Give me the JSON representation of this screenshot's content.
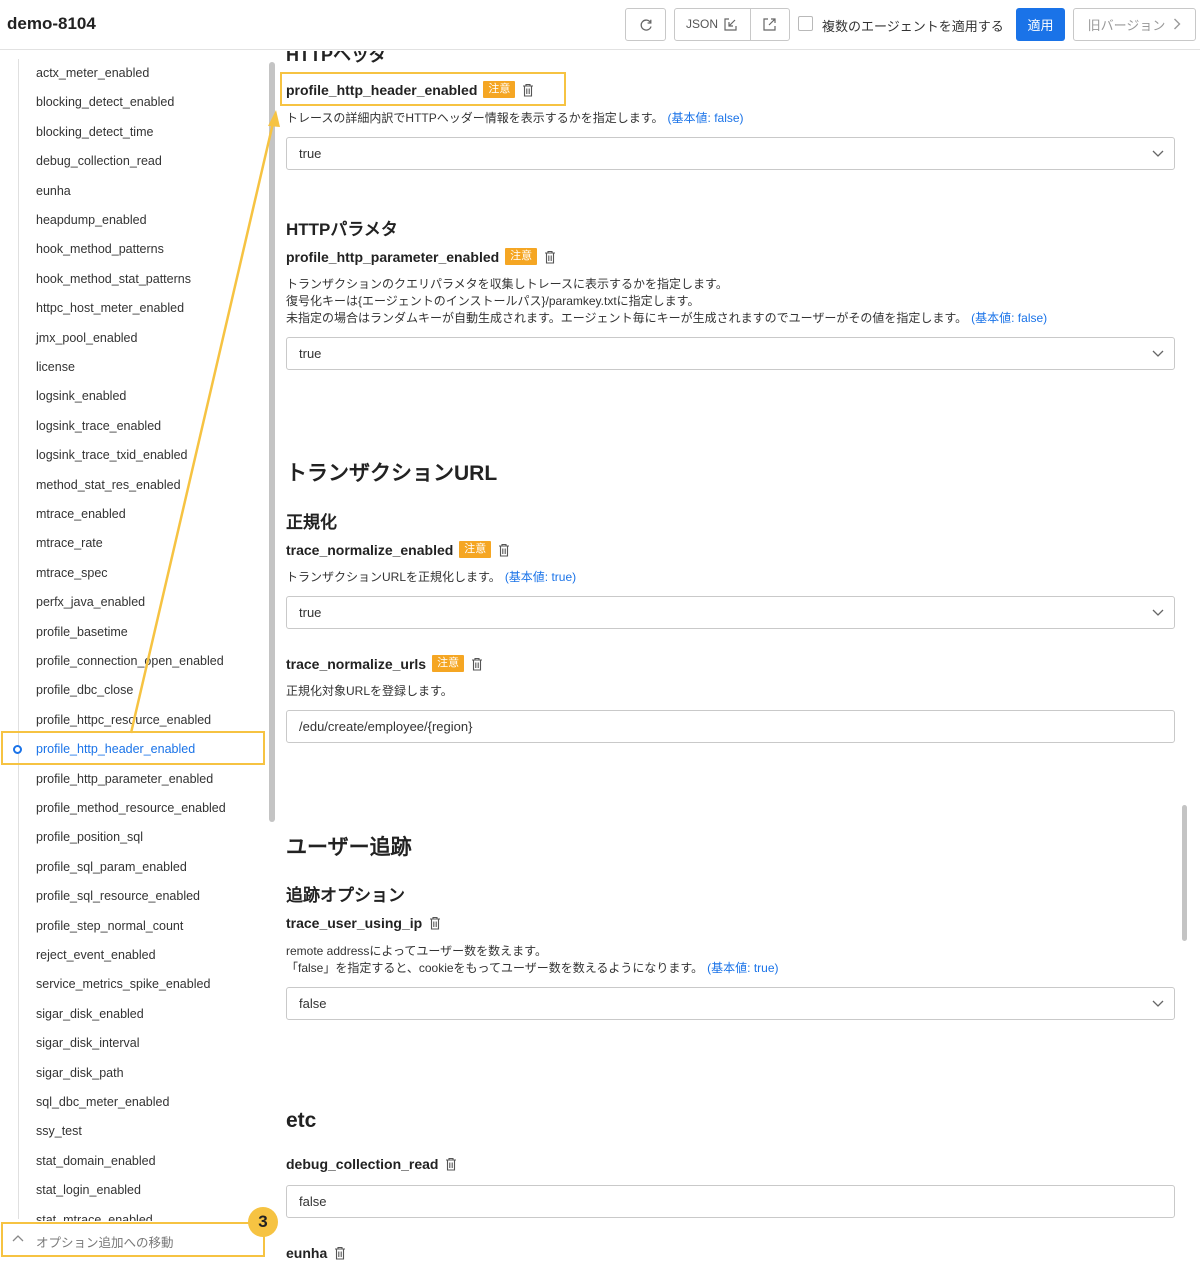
{
  "header": {
    "title": "demo-8104",
    "json_label": "JSON",
    "multi_agent_label": "複数のエージェントを適用する",
    "apply_label": "適用",
    "old_version_label": "旧バージョン"
  },
  "sidebar": {
    "items": [
      "actx_meter_enabled",
      "blocking_detect_enabled",
      "blocking_detect_time",
      "debug_collection_read",
      "eunha",
      "heapdump_enabled",
      "hook_method_patterns",
      "hook_method_stat_patterns",
      "httpc_host_meter_enabled",
      "jmx_pool_enabled",
      "license",
      "logsink_enabled",
      "logsink_trace_enabled",
      "logsink_trace_txid_enabled",
      "method_stat_res_enabled",
      "mtrace_enabled",
      "mtrace_rate",
      "mtrace_spec",
      "perfx_java_enabled",
      "profile_basetime",
      "profile_connection_open_enabled",
      "profile_dbc_close",
      "profile_httpc_resource_enabled",
      "profile_http_header_enabled",
      "profile_http_parameter_enabled",
      "profile_method_resource_enabled",
      "profile_position_sql",
      "profile_sql_param_enabled",
      "profile_sql_resource_enabled",
      "profile_step_normal_count",
      "reject_event_enabled",
      "service_metrics_spike_enabled",
      "sigar_disk_enabled",
      "sigar_disk_interval",
      "sigar_disk_path",
      "sql_dbc_meter_enabled",
      "ssy_test",
      "stat_domain_enabled",
      "stat_login_enabled",
      "stat_mtrace_enabled"
    ],
    "active_index": 23,
    "footer_label": "オプション追加への移動"
  },
  "main": {
    "cut_heading": "HTTPヘッダ",
    "http_header": {
      "name": "profile_http_header_enabled",
      "warn": "注意",
      "desc": "トレースの詳細内訳でHTTPヘッダー情報を表示するかを指定します。",
      "default": "(基本値: false)",
      "value": "true"
    },
    "http_param_heading": "HTTPパラメタ",
    "http_param": {
      "name": "profile_http_parameter_enabled",
      "warn": "注意",
      "desc1": "トランザクションのクエリパラメタを収集しトレースに表示するかを指定します。",
      "desc2": "復号化キーは{エージェントのインストールパス}/paramkey.txtに指定します。",
      "desc3": "未指定の場合はランダムキーが自動生成されます。エージェント毎にキーが生成されますのでユーザーがその値を指定します。",
      "default": "(基本値: false)",
      "value": "true"
    },
    "tx_url_heading": "トランザクションURL",
    "normalize_heading": "正規化",
    "trace_normalize_enabled": {
      "name": "trace_normalize_enabled",
      "warn": "注意",
      "desc": "トランザクションURLを正規化します。",
      "default": "(基本値: true)",
      "value": "true"
    },
    "trace_normalize_urls": {
      "name": "trace_normalize_urls",
      "warn": "注意",
      "desc": "正規化対象URLを登録します。",
      "value": "/edu/create/employee/{region}"
    },
    "user_tracking_heading": "ユーザー追跡",
    "tracking_option_heading": "追跡オプション",
    "trace_user_using_ip": {
      "name": "trace_user_using_ip",
      "desc1": "remote addressによってユーザー数を数えます。",
      "desc2": "「false」を指定すると、cookieをもってユーザー数を数えるようになります。",
      "default": "(基本値: true)",
      "value": "false"
    },
    "etc_heading": "etc",
    "debug_collection_read": {
      "name": "debug_collection_read",
      "value": "false"
    },
    "eunha": {
      "name": "eunha"
    }
  },
  "overlay": {
    "badge_number": "3"
  },
  "colors": {
    "accent": "#1a73e8",
    "warn": "#f5a623",
    "highlight": "#f6c342"
  }
}
